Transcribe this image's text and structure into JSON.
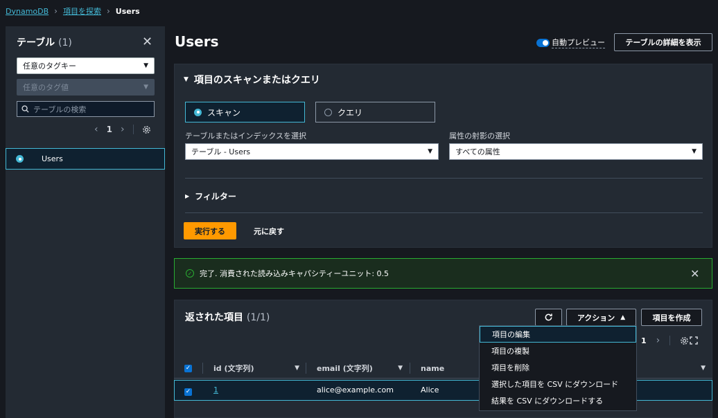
{
  "breadcrumb": {
    "root": "DynamoDB",
    "explore": "項目を探索",
    "current": "Users"
  },
  "sidebar": {
    "title": "テーブル",
    "count": "(1)",
    "tag_key_placeholder": "任意のタグキー",
    "tag_value_placeholder": "任意のタグ値",
    "search_placeholder": "テーブルの検索",
    "page": "1",
    "items": [
      {
        "label": "Users",
        "selected": true
      }
    ]
  },
  "header": {
    "title": "Users",
    "auto_preview_label": "自動プレビュー",
    "auto_preview_on": true,
    "details_button": "テーブルの詳細を表示"
  },
  "scan": {
    "title": "項目のスキャンまたはクエリ",
    "scan_option": "スキャン",
    "query_option": "クエリ",
    "selected": "scan",
    "table_label": "テーブルまたはインデックスを選択",
    "table_value": "テーブル - Users",
    "projection_label": "属性の射影の選択",
    "projection_value": "すべての属性",
    "filter_label": "フィルター",
    "run_button": "実行する",
    "reset_button": "元に戻す"
  },
  "alert": {
    "message": "完了. 消費された読み込みキャパシティーユニット: 0.5"
  },
  "results": {
    "title": "返された項目",
    "count": "(1/1)",
    "actions_button": "アクション",
    "create_button": "項目を作成",
    "page": "1",
    "columns": [
      "id (文字列)",
      "email (文字列)",
      "name"
    ],
    "rows": [
      {
        "id": "1",
        "email": "alice@example.com",
        "name": "Alice",
        "selected": true
      }
    ]
  },
  "actions_menu": {
    "items": [
      "項目の編集",
      "項目の複製",
      "項目を削除",
      "選択した項目を CSV にダウンロード",
      "結果を CSV にダウンロードする"
    ]
  },
  "colors": {
    "accent": "#44b9d6",
    "primary": "#ff9900",
    "success": "#29ad32",
    "toggle": "#0972d3"
  }
}
